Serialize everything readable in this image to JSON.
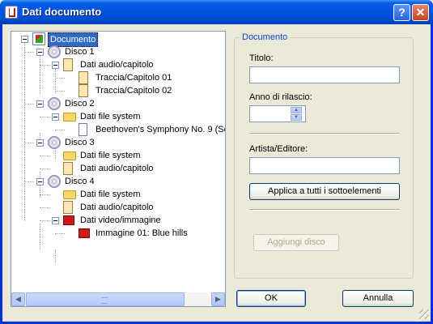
{
  "window": {
    "title": "Dati documento"
  },
  "tree": {
    "nodes": [
      {
        "label": "Documento",
        "icon": "document-icon",
        "selected": true
      },
      {
        "label": "Disco 1",
        "icon": "disc-icon"
      },
      {
        "label": "Dati audio/capitolo",
        "icon": "audio-folder-icon"
      },
      {
        "label": "Traccia/Capitolo 01",
        "icon": "music-file-icon"
      },
      {
        "label": "Traccia/Capitolo 02",
        "icon": "music-file-icon"
      },
      {
        "label": "Disco 2",
        "icon": "disc-icon"
      },
      {
        "label": "Dati file system",
        "icon": "folder-icon"
      },
      {
        "label": "Beethoven's Symphony No. 9 (Sc",
        "icon": "file-icon"
      },
      {
        "label": "Disco 3",
        "icon": "disc-icon"
      },
      {
        "label": "Dati file system",
        "icon": "folder-icon"
      },
      {
        "label": "Dati audio/capitolo",
        "icon": "audio-folder-icon"
      },
      {
        "label": "Disco 4",
        "icon": "disc-icon"
      },
      {
        "label": "Dati file system",
        "icon": "folder-icon"
      },
      {
        "label": "Dati audio/capitolo",
        "icon": "audio-folder-icon"
      },
      {
        "label": "Dati video/immagine",
        "icon": "video-folder-icon"
      },
      {
        "label": "Immagine 01: Blue hills",
        "icon": "image-icon"
      }
    ]
  },
  "panel": {
    "group_title": "Documento",
    "title_label": "Titolo:",
    "title_value": "",
    "year_label": "Anno di rilascio:",
    "year_value": "",
    "artist_label": "Artista/Editore:",
    "artist_value": "",
    "apply_button": "Applica a tutti i sottoelementi",
    "add_disc_button": "Aggiungi disco"
  },
  "footer": {
    "ok": "OK",
    "cancel": "Annulla"
  },
  "colors": {
    "titlebar": "#0054e3",
    "selection": "#316ac5",
    "group_title": "#0046d5",
    "face": "#ece9d8"
  }
}
